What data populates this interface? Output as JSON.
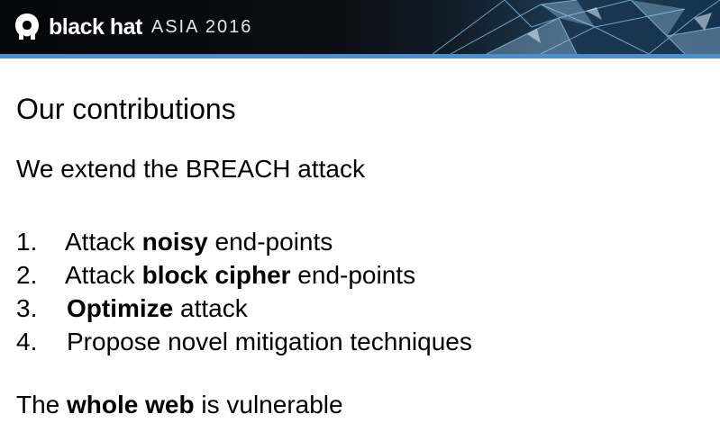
{
  "header": {
    "brand": "black hat",
    "event": "ASIA 2016",
    "accent_color": "#4a8fcf"
  },
  "slide": {
    "title": "Our contributions",
    "intro": "We extend the BREACH attack",
    "items": [
      {
        "number": "1.",
        "before": "Attack ",
        "bold": "noisy",
        "after": " end-points"
      },
      {
        "number": "2.",
        "before": "Attack ",
        "bold": "block cipher",
        "after": " end-points"
      },
      {
        "number": "3.",
        "before": "",
        "bold": "Optimize",
        "after": " attack"
      },
      {
        "number": "4.",
        "before": "Propose novel mitigation techniques",
        "bold": "",
        "after": ""
      }
    ],
    "closing": {
      "before": "The ",
      "bold": "whole web",
      "after": " is vulnerable"
    }
  }
}
